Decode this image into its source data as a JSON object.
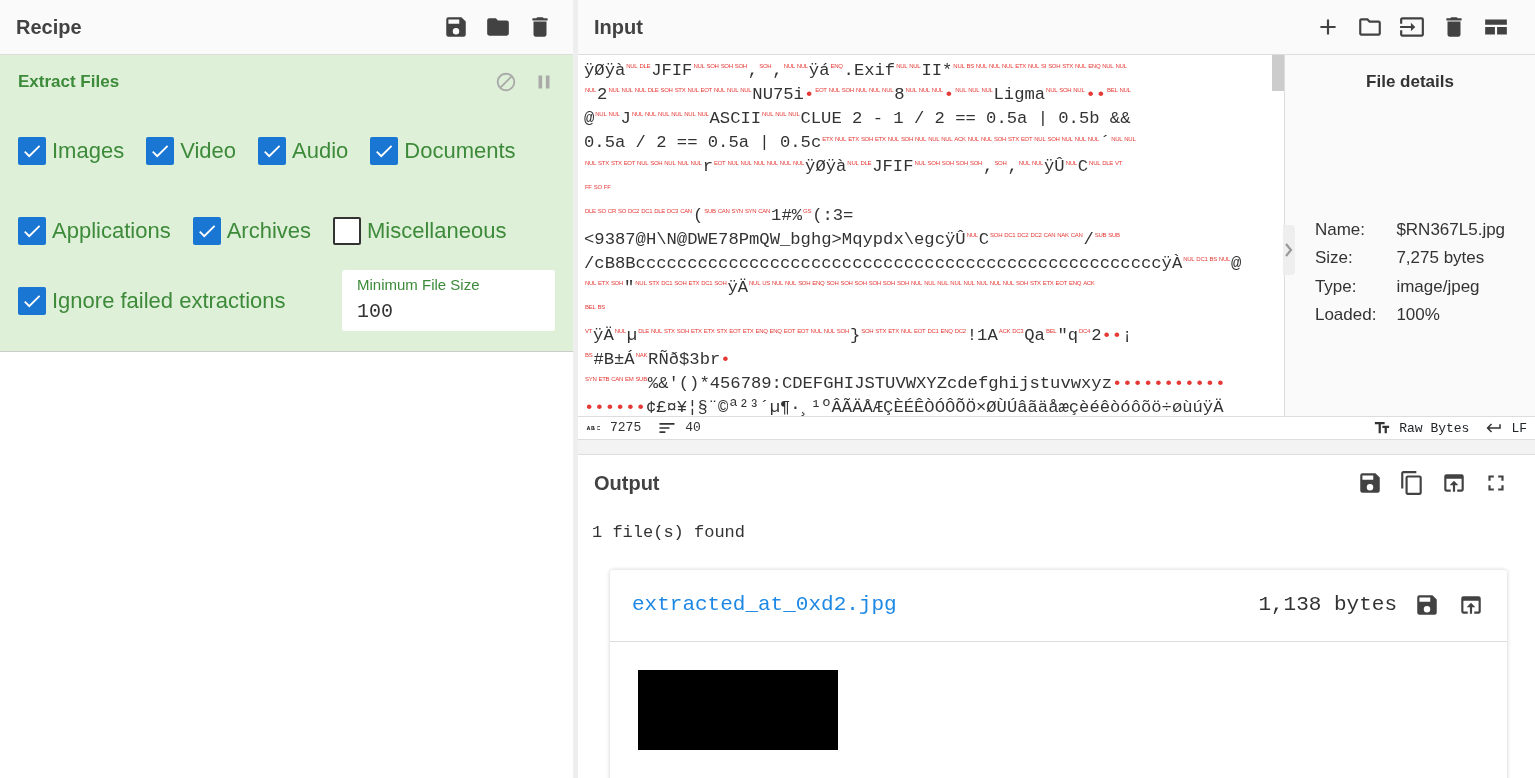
{
  "recipe": {
    "title": "Recipe",
    "operation": {
      "title": "Extract Files",
      "option_rows": [
        [
          {
            "label": "Images",
            "checked": true
          },
          {
            "label": "Video",
            "checked": true
          },
          {
            "label": "Audio",
            "checked": true
          },
          {
            "label": "Documents",
            "checked": true
          }
        ],
        [
          {
            "label": "Applications",
            "checked": true
          },
          {
            "label": "Archives",
            "checked": true
          },
          {
            "label": "Miscellaneous",
            "checked": false
          }
        ]
      ],
      "ignore_failed": {
        "label": "Ignore failed extractions",
        "checked": true
      },
      "min_size": {
        "label": "Minimum File Size",
        "value": "100"
      }
    }
  },
  "input": {
    "title": "Input",
    "editor_lines": [
      [
        {
          "kind": "text",
          "text": "ÿØÿà"
        },
        {
          "kind": "ctrl",
          "codes": [
            "NUL",
            "DLE"
          ]
        },
        {
          "kind": "text",
          "text": "JFIF"
        },
        {
          "kind": "ctrl",
          "codes": [
            "NUL",
            "SOH",
            "SOH",
            "SOH"
          ]
        },
        {
          "kind": "text",
          "text": ","
        },
        {
          "kind": "ctrl",
          "codes": [
            "SOH"
          ]
        },
        {
          "kind": "text",
          "text": ","
        },
        {
          "kind": "ctrl",
          "codes": [
            "NUL",
            "NUL"
          ]
        },
        {
          "kind": "text",
          "text": "ÿá"
        },
        {
          "kind": "ctrl",
          "codes": [
            "ENQ"
          ]
        },
        {
          "kind": "text",
          "text": ".Exif"
        },
        {
          "kind": "ctrl",
          "codes": [
            "NUL",
            "NUL"
          ]
        },
        {
          "kind": "text",
          "text": "II*"
        },
        {
          "kind": "ctrl",
          "codes": [
            "NUL",
            "BS",
            "NUL",
            "NUL",
            "NUL",
            "ETX",
            "NUL",
            "SI",
            "SOH",
            "STX",
            "NUL",
            "ENQ",
            "NUL",
            "NUL"
          ]
        }
      ],
      [
        {
          "kind": "ctrl",
          "codes": [
            "NUL"
          ]
        },
        {
          "kind": "text",
          "text": "2"
        },
        {
          "kind": "ctrl",
          "codes": [
            "NUL",
            "NUL",
            "NUL",
            "DLE",
            "SOH",
            "STX",
            "NUL",
            "EOT",
            "NUL",
            "NUL",
            "NUL"
          ]
        },
        {
          "kind": "text",
          "text": "NU75i"
        },
        {
          "kind": "dot",
          "text": "•"
        },
        {
          "kind": "ctrl",
          "codes": [
            "EOT",
            "NUL",
            "SOH",
            "NUL",
            "NUL",
            "NUL"
          ]
        },
        {
          "kind": "text",
          "text": "8"
        },
        {
          "kind": "ctrl",
          "codes": [
            "NUL",
            "NUL",
            "NUL"
          ]
        },
        {
          "kind": "dot",
          "text": "•"
        },
        {
          "kind": "ctrl",
          "codes": [
            "NUL",
            "NUL",
            "NUL"
          ]
        },
        {
          "kind": "text",
          "text": "Ligma"
        },
        {
          "kind": "ctrl",
          "codes": [
            "NUL",
            "SOH",
            "NUL"
          ]
        },
        {
          "kind": "dot",
          "text": "••"
        },
        {
          "kind": "ctrl",
          "codes": [
            "BEL",
            "NUL"
          ]
        }
      ],
      [
        {
          "kind": "text",
          "text": "@"
        },
        {
          "kind": "ctrl",
          "codes": [
            "NUL",
            "NUL"
          ]
        },
        {
          "kind": "text",
          "text": "J"
        },
        {
          "kind": "ctrl",
          "codes": [
            "NUL",
            "NUL",
            "NUL",
            "NUL",
            "NUL",
            "NUL"
          ]
        },
        {
          "kind": "text",
          "text": "ASCII"
        },
        {
          "kind": "ctrl",
          "codes": [
            "NUL",
            "NUL",
            "NUL"
          ]
        },
        {
          "kind": "text",
          "text": "CLUE 2 - 1 / 2 == 0.5a | 0.5b &&"
        }
      ],
      [
        {
          "kind": "text",
          "text": "0.5a / 2 == 0.5a | 0.5c"
        },
        {
          "kind": "ctrl",
          "codes": [
            "ETX",
            "NUL",
            "ETX",
            "SOH",
            "ETX",
            "NUL",
            "SOH",
            "NUL",
            "NUL",
            "NUL",
            "ACK",
            "NUL",
            "NUL",
            "SOH",
            "STX",
            "EOT",
            "NUL",
            "SOH",
            "NUL",
            "NUL",
            "NUL"
          ]
        },
        {
          "kind": "text",
          "text": "´"
        },
        {
          "kind": "ctrl",
          "codes": [
            "NUL",
            "NUL"
          ]
        }
      ],
      [
        {
          "kind": "ctrl",
          "codes": [
            "NUL",
            "STX",
            "STX",
            "EOT",
            "NUL",
            "SOH",
            "NUL",
            "NUL",
            "NUL"
          ]
        },
        {
          "kind": "text",
          "text": "r"
        },
        {
          "kind": "ctrl",
          "codes": [
            "EOT",
            "NUL",
            "NUL",
            "NUL",
            "NUL",
            "NUL",
            "NUL"
          ]
        },
        {
          "kind": "text",
          "text": "ÿØÿà"
        },
        {
          "kind": "ctrl",
          "codes": [
            "NUL",
            "DLE"
          ]
        },
        {
          "kind": "text",
          "text": "JFIF"
        },
        {
          "kind": "ctrl",
          "codes": [
            "NUL",
            "SOH",
            "SOH",
            "SOH",
            "SOH"
          ]
        },
        {
          "kind": "text",
          "text": ","
        },
        {
          "kind": "ctrl",
          "codes": [
            "SOH"
          ]
        },
        {
          "kind": "text",
          "text": ","
        },
        {
          "kind": "ctrl",
          "codes": [
            "NUL",
            "NUL"
          ]
        },
        {
          "kind": "text",
          "text": "ÿÛ"
        },
        {
          "kind": "ctrl",
          "codes": [
            "NUL"
          ]
        },
        {
          "kind": "text",
          "text": "C"
        },
        {
          "kind": "ctrl",
          "codes": [
            "NUL",
            "DLE",
            "VT"
          ]
        }
      ],
      [
        {
          "kind": "ctrl",
          "codes": [
            "FF",
            "SO",
            "FF"
          ]
        }
      ],
      [
        {
          "kind": "ctrl",
          "codes": [
            "DLE",
            "SO",
            "CR",
            "SO",
            "DC2",
            "DC1",
            "DLE",
            "DC3",
            "CAN"
          ]
        },
        {
          "kind": "text",
          "text": "("
        },
        {
          "kind": "ctrl",
          "codes": [
            "SUB",
            "CAN",
            "SYN",
            "SYN",
            "CAN"
          ]
        },
        {
          "kind": "text",
          "text": "1#%"
        },
        {
          "kind": "ctrl",
          "codes": [
            "GS"
          ]
        },
        {
          "kind": "text",
          "text": "(:3="
        }
      ],
      [
        {
          "kind": "text",
          "text": "<9387@H\\N@DWE78PmQW_bghg>Mqypdx\\egcÿÛ"
        },
        {
          "kind": "ctrl",
          "codes": [
            "NUL"
          ]
        },
        {
          "kind": "text",
          "text": "C"
        },
        {
          "kind": "ctrl",
          "codes": [
            "SOH",
            "DC1",
            "DC2",
            "DC2",
            "CAN",
            "NAK",
            "CAN"
          ]
        },
        {
          "kind": "text",
          "text": "/"
        },
        {
          "kind": "ctrl",
          "codes": [
            "SUB",
            "SUB"
          ]
        }
      ],
      [
        {
          "kind": "text",
          "text": "/cB8BcccccccccccccccccccccccccccccccccccccccccccccccccccÿÀ"
        },
        {
          "kind": "ctrl",
          "codes": [
            "NUL",
            "DC1",
            "BS",
            "NUL"
          ]
        },
        {
          "kind": "text",
          "text": "@"
        }
      ],
      [
        {
          "kind": "ctrl",
          "codes": [
            "NUL",
            "ETX",
            "SOH"
          ]
        },
        {
          "kind": "text",
          "text": "\""
        },
        {
          "kind": "ctrl",
          "codes": [
            "NUL",
            "STX",
            "DC1",
            "SOH",
            "ETX",
            "DC1",
            "SOH"
          ]
        },
        {
          "kind": "text",
          "text": "ÿÄ"
        },
        {
          "kind": "ctrl",
          "codes": [
            "NUL",
            "US",
            "NUL",
            "NUL",
            "SOH",
            "ENQ",
            "SOH",
            "SOH",
            "SOH",
            "SOH",
            "SOH",
            "SOH",
            "NUL",
            "NUL",
            "NUL",
            "NUL",
            "NUL",
            "NUL",
            "NUL",
            "NUL",
            "SOH",
            "STX",
            "ETX",
            "EOT",
            "ENQ",
            "ACK"
          ]
        }
      ],
      [
        {
          "kind": "ctrl",
          "codes": [
            "BEL",
            "BS"
          ]
        }
      ],
      [
        {
          "kind": "ctrl",
          "codes": [
            "VT"
          ]
        },
        {
          "kind": "text",
          "text": "ÿÄ"
        },
        {
          "kind": "ctrl",
          "codes": [
            "NUL"
          ]
        },
        {
          "kind": "text",
          "text": "µ"
        },
        {
          "kind": "ctrl",
          "codes": [
            "DLE",
            "NUL",
            "STX",
            "SOH",
            "ETX",
            "ETX",
            "STX",
            "EOT",
            "ETX",
            "ENQ",
            "ENQ",
            "EOT",
            "EOT",
            "NUL",
            "NUL",
            "SOH"
          ]
        },
        {
          "kind": "text",
          "text": "}"
        },
        {
          "kind": "ctrl",
          "codes": [
            "SOH",
            "STX",
            "ETX",
            "NUL",
            "EOT",
            "DC1",
            "ENQ",
            "DC2"
          ]
        },
        {
          "kind": "text",
          "text": "!1A"
        },
        {
          "kind": "ctrl",
          "codes": [
            "ACK",
            "DC3"
          ]
        },
        {
          "kind": "text",
          "text": "Qa"
        },
        {
          "kind": "ctrl",
          "codes": [
            "BEL"
          ]
        },
        {
          "kind": "text",
          "text": "\"q"
        },
        {
          "kind": "ctrl",
          "codes": [
            "DC4"
          ]
        },
        {
          "kind": "text",
          "text": "2"
        },
        {
          "kind": "dot",
          "text": "••"
        },
        {
          "kind": "text",
          "text": "¡"
        }
      ],
      [
        {
          "kind": "ctrl",
          "codes": [
            "BS"
          ]
        },
        {
          "kind": "text",
          "text": "#B±Á"
        },
        {
          "kind": "ctrl",
          "codes": [
            "NAK"
          ]
        },
        {
          "kind": "text",
          "text": "RÑð$3br"
        },
        {
          "kind": "dot",
          "text": "•"
        }
      ],
      [
        {
          "kind": "ctrl",
          "codes": [
            "SYN",
            "ETB",
            "CAN",
            "EM",
            "SUB"
          ]
        },
        {
          "kind": "text",
          "text": "%&'()*456789:CDEFGHIJSTUVWXYZcdefghijstuvwxyz"
        },
        {
          "kind": "dot",
          "text": "•••••••••••"
        }
      ],
      [
        {
          "kind": "dot",
          "text": "••••••"
        },
        {
          "kind": "text",
          "text": "¢£¤¥¦§¨©ª²³´µ¶·¸¹ºÂÃÄÅÆÇÈÉÊÒÓÔÕÖ×ØÙÚâãäåæçèéêòóôõö÷øùúÿÄ"
        }
      ]
    ],
    "file_details": {
      "title": "File details",
      "rows": [
        {
          "label": "Name:",
          "value": "$RN367L5.jpg"
        },
        {
          "label": "Size:",
          "value": "7,275 bytes"
        },
        {
          "label": "Type:",
          "value": "image/jpeg"
        },
        {
          "label": "Loaded:",
          "value": "100%"
        }
      ]
    },
    "status": {
      "length": "7275",
      "lines": "40",
      "encoding": "Raw Bytes",
      "eol": "LF"
    }
  },
  "output": {
    "title": "Output",
    "message": "1 file(s) found",
    "file": {
      "name": "extracted_at_0xd2.jpg",
      "size": "1,138 bytes"
    }
  }
}
